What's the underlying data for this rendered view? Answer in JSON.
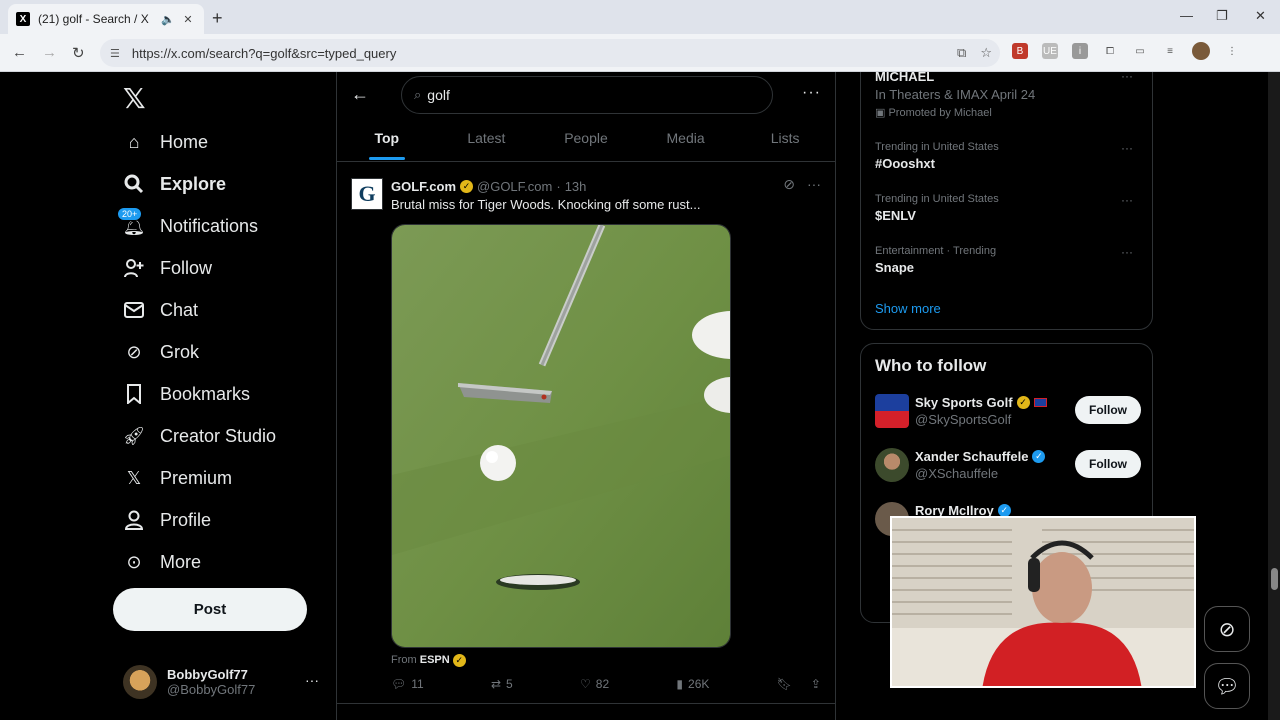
{
  "browser": {
    "tab_title": "(21) golf - Search / X",
    "favicon": "X",
    "url": "https://x.com/search?q=golf&src=typed_query"
  },
  "nav": {
    "items": [
      {
        "label": "Home",
        "icon": "home-icon"
      },
      {
        "label": "Explore",
        "icon": "search-icon"
      },
      {
        "label": "Notifications",
        "icon": "bell-icon",
        "badge": "20+"
      },
      {
        "label": "Follow",
        "icon": "person-plus-icon"
      },
      {
        "label": "Chat",
        "icon": "mail-icon"
      },
      {
        "label": "Grok",
        "icon": "grok-icon"
      },
      {
        "label": "Bookmarks",
        "icon": "bookmark-icon"
      },
      {
        "label": "Creator Studio",
        "icon": "rocket-icon"
      },
      {
        "label": "Premium",
        "icon": "x-icon"
      },
      {
        "label": "Profile",
        "icon": "person-icon"
      },
      {
        "label": "More",
        "icon": "more-circle-icon"
      }
    ],
    "post_label": "Post",
    "account": {
      "name": "BobbyGolf77",
      "handle": "@BobbyGolf77"
    }
  },
  "search": {
    "query": "golf",
    "tabs": [
      "Top",
      "Latest",
      "People",
      "Media",
      "Lists"
    ],
    "selected_tab": "Top"
  },
  "tweet": {
    "name": "GOLF.com",
    "handle": "@GOLF.com",
    "time": "13h",
    "text": "Brutal miss for Tiger Woods. Knocking off some rust...",
    "from_prefix": "From",
    "from_source": "ESPN",
    "replies": "11",
    "reposts": "5",
    "likes": "82",
    "views": "26K"
  },
  "trends": {
    "promo": {
      "title": "MICHAEL",
      "line": "In Theaters & IMAX April 24",
      "promoted": "Promoted by Michael"
    },
    "items": [
      {
        "meta": "Trending in United States",
        "name": "#Oooshxt"
      },
      {
        "meta": "Trending in United States",
        "name": "$ENLV"
      },
      {
        "meta": "Entertainment · Trending",
        "name": "Snape"
      }
    ],
    "show_more": "Show more"
  },
  "who_to_follow": {
    "title": "Who to follow",
    "accounts": [
      {
        "name": "Sky Sports Golf",
        "handle": "@SkySportsGolf",
        "badge": "gold"
      },
      {
        "name": "Xander Schauffele",
        "handle": "@XSchauffele",
        "badge": "blue"
      },
      {
        "name": "Rory McIlroy",
        "handle": "",
        "badge": "blue"
      }
    ],
    "follow_label": "Follow"
  },
  "colors": {
    "accent": "#1d9bf0",
    "background": "#000000",
    "text": "#e7e9ea",
    "muted": "#71767b"
  }
}
